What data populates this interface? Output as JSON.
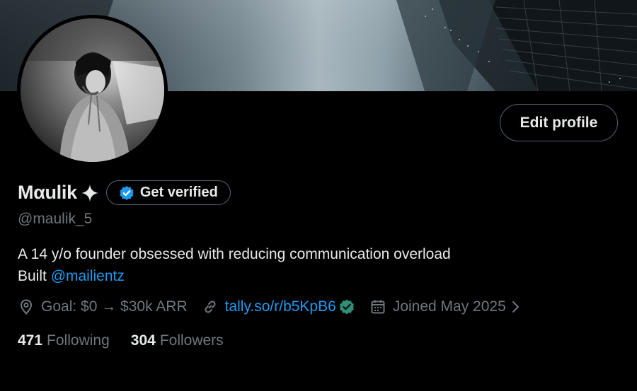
{
  "profile": {
    "display_name": "Mαulik",
    "handle": "@maulik_5",
    "get_verified_label": "Get verified",
    "edit_profile_label": "Edit profile",
    "bio_line1": "A 14 y/o founder obsessed with reducing communication overload",
    "bio_line2_prefix": "Built ",
    "bio_mention": "@mailientz",
    "location": "Goal: $0 → $30k ARR",
    "url": "tally.so/r/b5KpB6",
    "joined": "Joined May 2025",
    "following_count": "471",
    "following_label": "Following",
    "followers_count": "304",
    "followers_label": "Followers"
  },
  "icons": {
    "name_badge": "sparkle-icon",
    "verify_badge": "verified-badge-icon",
    "location": "location-pin-icon",
    "url": "link-icon",
    "url_badge": "verified-check-icon",
    "joined": "calendar-icon",
    "joined_chevron": "chevron-right-icon"
  },
  "colors": {
    "background": "#000000",
    "text_primary": "#e7e9ea",
    "text_secondary": "#71767b",
    "accent_blue": "#1d9bf0",
    "border": "#536471",
    "url_check_green": "#2e8f77"
  }
}
